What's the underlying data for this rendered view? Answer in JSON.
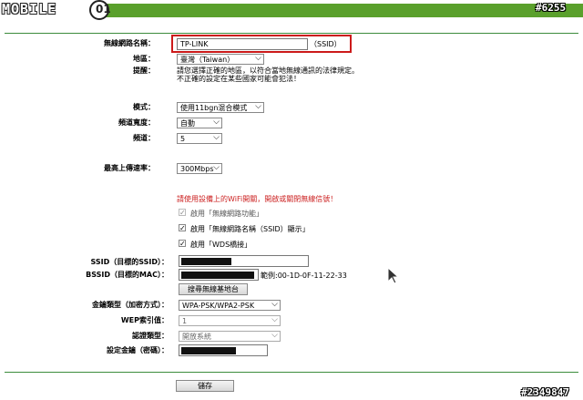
{
  "watermark": {
    "logo": "MOBILE",
    "logo_mark": "01",
    "top_id": "#6255",
    "bottom_id": "#2349847"
  },
  "wireless": {
    "ssid_label": "無線網路名稱：",
    "ssid_value": "TP-LINK",
    "ssid_suffix": "（SSID）",
    "region_label": "地區：",
    "region_value": "臺灣（Taiwan）",
    "warning_label": "提醒：",
    "warning_line1": "請您選擇正確的地區，以符合當地無線通訊的法律規定。",
    "warning_line2": "不正確的設定在某些國家可能會犯法！",
    "mode_label": "模式：",
    "mode_value": "使用11bgn混合模式",
    "bandwidth_label": "頻道寬度：",
    "bandwidth_value": "自動",
    "channel_label": "頻道：",
    "channel_value": "5",
    "maxrate_label": "最高上傳速率：",
    "maxrate_value": "300Mbps"
  },
  "wds": {
    "notice": "請使用設備上的WiFi開關，開啟或關閉無線信號！",
    "enable_radio": "啟用「無線網路功能」",
    "enable_ssid_broadcast": "啟用「無線網路名稱（SSID）顯示」",
    "enable_wds": "啟用「WDS橋接」",
    "ssid_label": "SSID（目標的SSID）：",
    "bssid_label": "BSSID（目標的MAC）：",
    "bssid_example": "範例:00-1D-0F-11-22-33",
    "survey_button": "搜尋無線基地台",
    "keytype_label": "金鑰類型（加密方式）：",
    "keytype_value": "WPA-PSK/WPA2-PSK",
    "wep_index_label": "WEP索引值：",
    "wep_index_value": "1",
    "auth_label": "認證類型：",
    "auth_value": "開放系統",
    "password_label": "設定金鑰（密碼）："
  },
  "save_button": "儲存",
  "colors": {
    "accent_green": "#5aa02c",
    "highlight_red": "#cc1a1a",
    "notice_red": "#cc2222"
  }
}
